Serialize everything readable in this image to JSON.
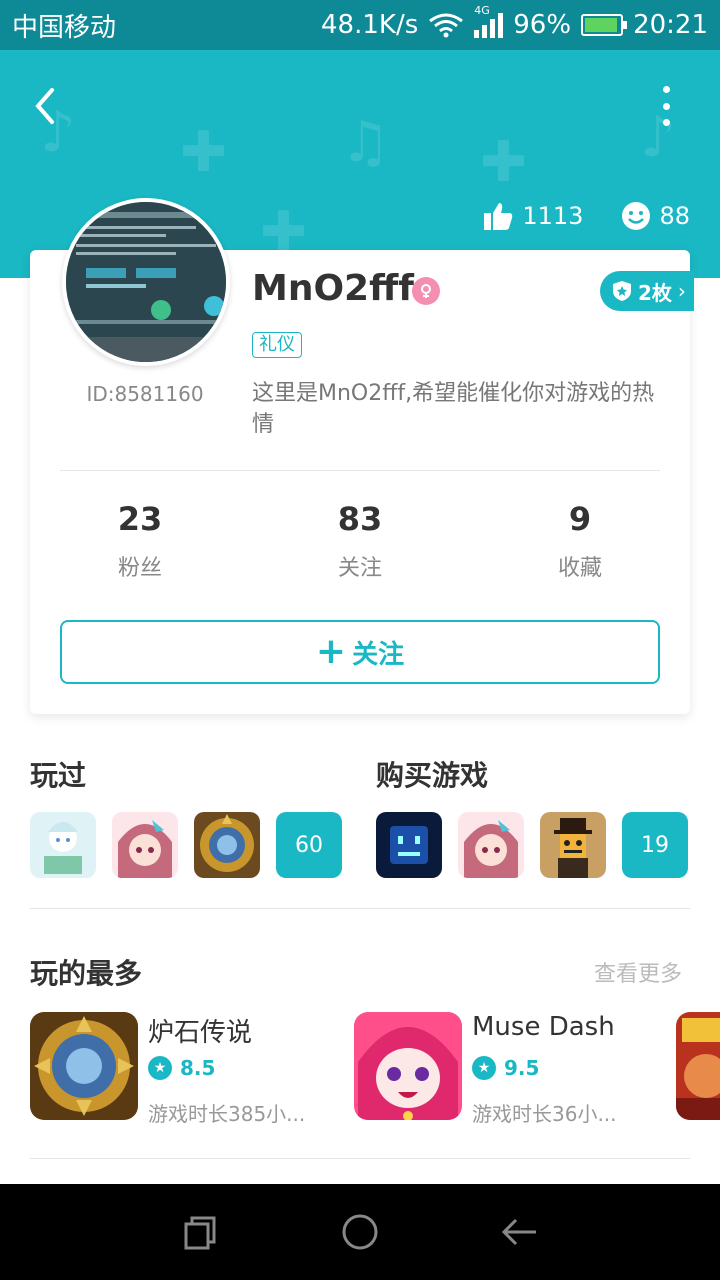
{
  "status_bar": {
    "carrier": "中国移动",
    "speed": "48.1K/s",
    "network": "4G",
    "battery": "96%",
    "time": "20:21"
  },
  "header": {
    "likes": "1113",
    "smiles": "88"
  },
  "profile": {
    "username": "MnO2fff",
    "user_id": "ID:8581160",
    "tag": "礼仪",
    "badge_count": "2枚",
    "bio": "这里是MnO2fff,希望能催化你对游戏的热情"
  },
  "stats": [
    {
      "num": "23",
      "label": "粉丝"
    },
    {
      "num": "83",
      "label": "关注"
    },
    {
      "num": "9",
      "label": "收藏"
    }
  ],
  "follow_label": "关注",
  "played": {
    "title": "玩过",
    "count": "60"
  },
  "bought": {
    "title": "购买游戏",
    "count": "19"
  },
  "most_played": {
    "title": "玩的最多",
    "see_more": "查看更多",
    "games": [
      {
        "name": "炉石传说",
        "rating": "8.5",
        "time": "游戏时长385小..."
      },
      {
        "name": "Muse Dash",
        "rating": "9.5",
        "time": "游戏时长36小..."
      }
    ]
  },
  "colors": {
    "accent": "#1ab8c4",
    "status_bar": "#0e8a96"
  }
}
